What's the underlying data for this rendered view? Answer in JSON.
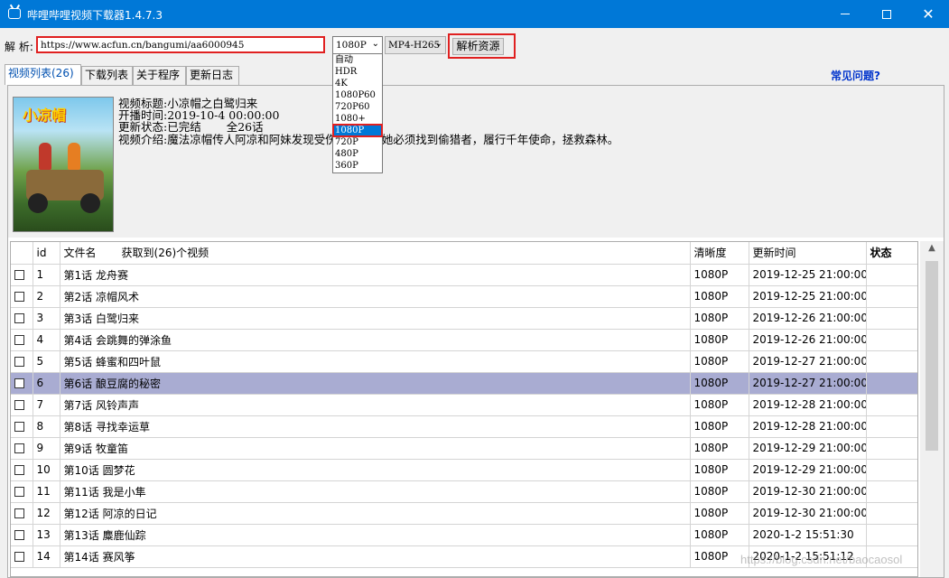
{
  "window": {
    "title": "哔哩哔哩视频下载器1.4.7.3",
    "close_glyph": "✕"
  },
  "parse": {
    "label": "解 析:",
    "url": "https://www.acfun.cn/bangumi/aa6000945",
    "resolution": "1080P",
    "codec": "MP4-H265",
    "button": "解析资源"
  },
  "resolution_options": [
    "自动",
    "HDR",
    "4K",
    "1080P60",
    "720P60",
    "1080+",
    "1080P",
    "720P",
    "480P",
    "360P"
  ],
  "tabs": [
    "视频列表(26)",
    "下载列表",
    "关于程序",
    "更新日志"
  ],
  "faq": "常见问题?",
  "video": {
    "title_label": "视频标题:",
    "title": "小凉帽之白鹭归来",
    "date_label": "开播时间:",
    "date": "2019-10-4 00:00:00",
    "status_label": "更新状态:",
    "status": "已完结",
    "episodes": "全26话",
    "desc_label": "视频介绍:",
    "desc": "魔法凉帽传人阿凉和阿妹发现受伤的白鹭，她必须找到偷猎者，履行千年使命，拯救森林。"
  },
  "table": {
    "headers": {
      "id": "id",
      "name": "文件名",
      "count": "获取到(26)个视频",
      "quality": "清晰度",
      "time": "更新时间",
      "state": "状态"
    },
    "rows": [
      {
        "id": "1",
        "name": "第1话 龙舟赛",
        "quality": "1080P",
        "time": "2019-12-25 21:00:00"
      },
      {
        "id": "2",
        "name": "第2话 凉帽风术",
        "quality": "1080P",
        "time": "2019-12-25 21:00:00"
      },
      {
        "id": "3",
        "name": "第3话 白鹭归来",
        "quality": "1080P",
        "time": "2019-12-26 21:00:00"
      },
      {
        "id": "4",
        "name": "第4话 会跳舞的弹涂鱼",
        "quality": "1080P",
        "time": "2019-12-26 21:00:00"
      },
      {
        "id": "5",
        "name": "第5话 蜂蜜和四叶鼠",
        "quality": "1080P",
        "time": "2019-12-27 21:00:00"
      },
      {
        "id": "6",
        "name": "第6话 酿豆腐的秘密",
        "quality": "1080P",
        "time": "2019-12-27 21:00:00"
      },
      {
        "id": "7",
        "name": "第7话 风铃声声",
        "quality": "1080P",
        "time": "2019-12-28 21:00:00"
      },
      {
        "id": "8",
        "name": "第8话 寻找幸运草",
        "quality": "1080P",
        "time": "2019-12-28 21:00:00"
      },
      {
        "id": "9",
        "name": "第9话 牧童笛",
        "quality": "1080P",
        "time": "2019-12-29 21:00:00"
      },
      {
        "id": "10",
        "name": "第10话 圆梦花",
        "quality": "1080P",
        "time": "2019-12-29 21:00:00"
      },
      {
        "id": "11",
        "name": "第11话 我是小隼",
        "quality": "1080P",
        "time": "2019-12-30 21:00:00"
      },
      {
        "id": "12",
        "name": "第12话 阿凉的日记",
        "quality": "1080P",
        "time": "2019-12-30 21:00:00"
      },
      {
        "id": "13",
        "name": "第13话 麋鹿仙踪",
        "quality": "1080P",
        "time": "2020-1-2 15:51:30"
      },
      {
        "id": "14",
        "name": "第14话 赛风筝",
        "quality": "1080P",
        "time": "2020-1-2 15:51:12"
      }
    ],
    "selected_row": 6
  },
  "watermark": "https://blog.csdn.net/baocaosol"
}
